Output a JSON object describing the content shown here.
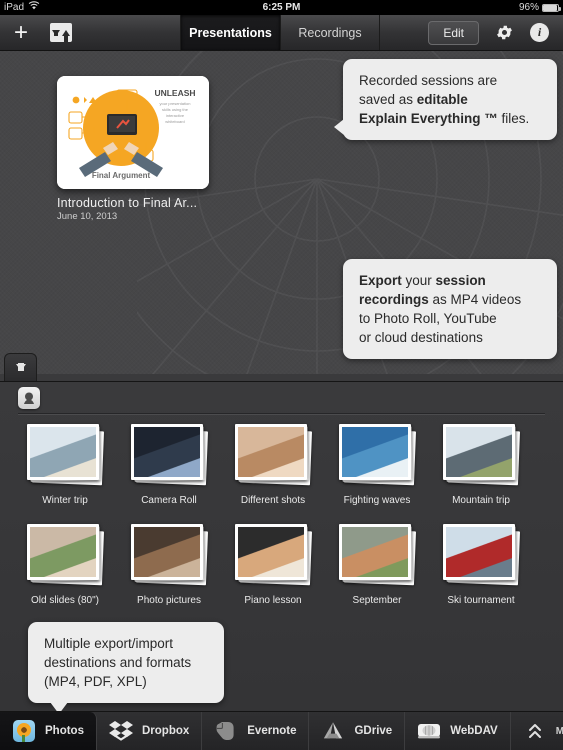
{
  "statusbar": {
    "device": "iPad",
    "wifi_icon": "wifi-icon",
    "time": "6:25 PM",
    "battery_percent": "96%",
    "battery_icon": "battery-icon"
  },
  "toolbar": {
    "add_icon": "plus-icon",
    "import_export_icon": "import-export-icon",
    "tabs": [
      {
        "label": "Presentations",
        "active": true
      },
      {
        "label": "Recordings",
        "active": false
      }
    ],
    "edit_label": "Edit",
    "settings_icon": "gear-icon",
    "info_icon": "info-icon"
  },
  "presentations": [
    {
      "title": "Introduction to Final Ar...",
      "date": "June 10, 2013",
      "thumbnail": {
        "headline": "UNLEASH",
        "subtext": "your presentation skills using the interactive whiteboard",
        "caption": "Final Argument"
      }
    }
  ],
  "collapse_handle": {
    "icon": "download-arrow-icon"
  },
  "photo_browser": {
    "source_icon": "photos-source-icon",
    "albums": [
      {
        "label": "Winter trip",
        "colors": [
          "#dbe5ec",
          "#8fa6b4",
          "#e8e2d4"
        ]
      },
      {
        "label": "Camera Roll",
        "colors": [
          "#1d2430",
          "#2f3b4c",
          "#8fa8c8"
        ]
      },
      {
        "label": "Different shots",
        "colors": [
          "#d8b79a",
          "#b98a63",
          "#efd9c2"
        ]
      },
      {
        "label": "Fighting waves",
        "colors": [
          "#2f6fa8",
          "#4f93c4",
          "#e9f1f5"
        ]
      },
      {
        "label": "Mountain trip",
        "colors": [
          "#d9e3ea",
          "#5d6b74",
          "#93a36b"
        ]
      },
      {
        "label": "Old slides (80\")",
        "colors": [
          "#cbb9a6",
          "#7d9a62",
          "#e3d4c0"
        ]
      },
      {
        "label": "Photo pictures",
        "colors": [
          "#4a3b30",
          "#8e6b4e",
          "#cbb39a"
        ]
      },
      {
        "label": "Piano lesson",
        "colors": [
          "#2c2c2c",
          "#d8a87c",
          "#efe6d8"
        ]
      },
      {
        "label": "September",
        "colors": [
          "#8f9a8a",
          "#c98f63",
          "#7f9a5c"
        ]
      },
      {
        "label": "Ski tournament",
        "colors": [
          "#cfdde8",
          "#b02a2a",
          "#6a7d8c"
        ]
      }
    ]
  },
  "callouts": [
    {
      "id": "callout-recorded-sessions",
      "lines": [
        {
          "segments": [
            {
              "text": "Recorded sessions are",
              "bold": false
            }
          ]
        },
        {
          "segments": [
            {
              "text": "saved as ",
              "bold": false
            },
            {
              "text": "editable",
              "bold": true
            }
          ]
        },
        {
          "segments": [
            {
              "text": "Explain Everything ™",
              "bold": true
            },
            {
              "text": " files.",
              "bold": false
            }
          ]
        }
      ]
    },
    {
      "id": "callout-export",
      "lines": [
        {
          "segments": [
            {
              "text": "Export",
              "bold": true
            },
            {
              "text": " your ",
              "bold": false
            },
            {
              "text": "session",
              "bold": true
            }
          ]
        },
        {
          "segments": [
            {
              "text": "recordings",
              "bold": true
            },
            {
              "text": " as MP4 videos",
              "bold": false
            }
          ]
        },
        {
          "segments": [
            {
              "text": "to Photo Roll, YouTube",
              "bold": false
            }
          ]
        },
        {
          "segments": [
            {
              "text": "or cloud destinations",
              "bold": false
            }
          ]
        }
      ]
    },
    {
      "id": "callout-destinations",
      "lines": [
        {
          "segments": [
            {
              "text": "Multiple export/import",
              "bold": false
            }
          ]
        },
        {
          "segments": [
            {
              "text": "destinations and formats",
              "bold": false
            }
          ]
        },
        {
          "segments": [
            {
              "text": "(MP4, PDF, XPL)",
              "bold": false
            }
          ]
        }
      ]
    }
  ],
  "destinations": [
    {
      "label": "Photos",
      "icon": "sunflower-icon",
      "active": true
    },
    {
      "label": "Dropbox",
      "icon": "dropbox-icon",
      "active": false
    },
    {
      "label": "Evernote",
      "icon": "evernote-icon",
      "active": false
    },
    {
      "label": "GDrive",
      "icon": "gdrive-icon",
      "active": false
    },
    {
      "label": "WebDAV",
      "icon": "harddisk-icon",
      "active": false
    },
    {
      "label": "MORE",
      "icon": "chevron-up-double-icon",
      "active": false
    }
  ],
  "colors": {
    "accent_orange": "#f5a623",
    "panel_bg": "#464648",
    "lower_bg": "#3a3a3c",
    "callout_bg": "#ededed",
    "toolbar_dark": "#2f2f31"
  }
}
